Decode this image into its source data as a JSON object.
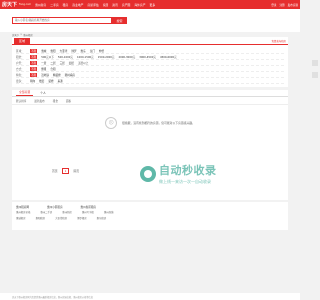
{
  "header": {
    "logo": "房天下",
    "logo_sub": "Fang.com",
    "nav": [
      "惠州新房",
      "二手房",
      "租房",
      "商业地产",
      "房屋评估",
      "家居",
      "资讯",
      "房产圈",
      "海外房产",
      "更多"
    ],
    "right_links": [
      "登录",
      "注册",
      "发布房源"
    ]
  },
  "search": {
    "placeholder": "输入小区名/路段名称开始找房",
    "button": "搜索"
  },
  "breadcrumb": [
    "房天下",
    ">",
    "惠州租房"
  ],
  "filter_card": {
    "tab": "区域",
    "hint": "免费发布租房",
    "rows": [
      {
        "label": "区域：",
        "options": [
          "不限",
          "惠城",
          "惠阳",
          "大亚湾",
          "博罗",
          "惠东",
          "龙门",
          "仲恺"
        ],
        "selected": 0
      },
      {
        "label": "租金：",
        "options": [
          "不限",
          "500元以下",
          "500-1000元",
          "1000-1500元",
          "1500-2000元",
          "2000-3000元",
          "3000-4500元",
          "4500-6000元"
        ],
        "selected": 0
      },
      {
        "label": "户型：",
        "options": [
          "不限",
          "一居",
          "二居",
          "三居",
          "四居",
          "五居以上"
        ],
        "selected": 0
      },
      {
        "label": "方式：",
        "options": [
          "不限",
          "整租",
          "合租"
        ],
        "selected": 0
      },
      {
        "label": "特色：",
        "options": [
          "不限",
          "近地铁",
          "精装修",
          "随时看房"
        ],
        "selected": 0
      },
      {
        "label": "更多：",
        "options": [
          "朝向",
          "楼层",
          "装修",
          "来源"
        ],
        "selected": -1
      }
    ]
  },
  "results": {
    "tabs": [
      "全部房源",
      "个人"
    ],
    "sort": [
      "默认排序",
      "最新发布",
      "租金",
      "面积"
    ],
    "empty_face": "☹",
    "empty_text": "很抱歉，没有找到相符的房源，您可能对以下房源感兴趣。",
    "pager": {
      "prev": "首页",
      "page": "1",
      "next": "尾页"
    }
  },
  "watermark": {
    "title": "自动秒收录",
    "subtitle": "做上线一来访一次一自动收录"
  },
  "links": {
    "titles": [
      "惠州租房网",
      "惠州小区租房",
      "惠州各区租房"
    ],
    "row1": [
      "惠州租房价格",
      "惠州二手房",
      "惠州新房",
      "惠州写字楼",
      "惠州商铺"
    ],
    "row2": [
      "惠城租房",
      "惠阳租房",
      "大亚湾租房",
      "博罗租房",
      "惠东租房"
    ]
  },
  "footer": {
    "text": "房天下惠州租房网为您提供惠州最新租房信息，惠州房屋出租、惠州租房价格等信息"
  }
}
